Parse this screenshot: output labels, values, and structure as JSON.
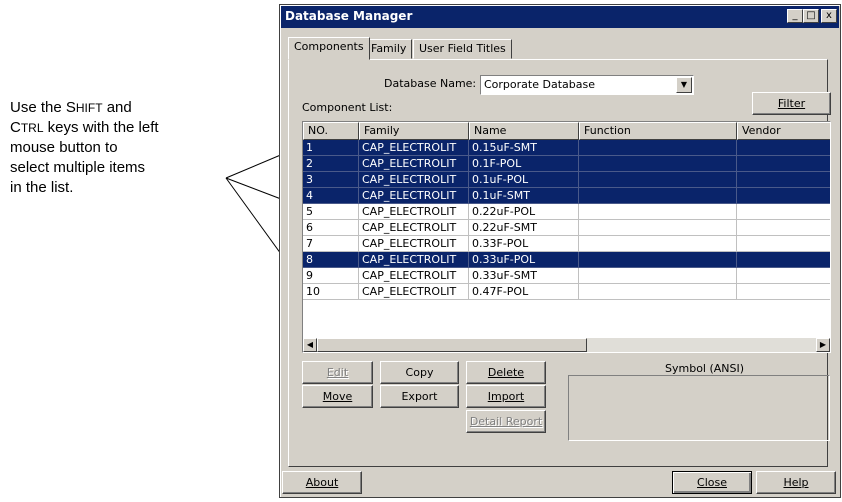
{
  "callout": {
    "line1_pre": "Use the S",
    "line1_sc": "HIFT",
    "line1_post": " and",
    "line2_pre": "C",
    "line2_sc": "TRL",
    "line2_post": " keys with the left",
    "line3": "mouse button to",
    "line4": "select multiple items",
    "line5": "in the list."
  },
  "window": {
    "title": "Database Manager",
    "minimize": "_",
    "maximize": "□",
    "close": "x"
  },
  "tabs": [
    "Components",
    "Family",
    "User Field Titles"
  ],
  "database": {
    "label": "Database Name:",
    "value": "Corporate Database"
  },
  "component_list_label": "Component List:",
  "filter_button": "Filter",
  "table": {
    "columns": [
      "NO.",
      "Family",
      "Name",
      "Function",
      "Vendor"
    ],
    "rows": [
      {
        "no": "1",
        "family": "CAP_ELECTROLIT",
        "name": "0.15uF-SMT",
        "function": "",
        "vendor": "",
        "selected": true
      },
      {
        "no": "2",
        "family": "CAP_ELECTROLIT",
        "name": "0.1F-POL",
        "function": "",
        "vendor": "",
        "selected": true
      },
      {
        "no": "3",
        "family": "CAP_ELECTROLIT",
        "name": "0.1uF-POL",
        "function": "",
        "vendor": "",
        "selected": true
      },
      {
        "no": "4",
        "family": "CAP_ELECTROLIT",
        "name": "0.1uF-SMT",
        "function": "",
        "vendor": "",
        "selected": true
      },
      {
        "no": "5",
        "family": "CAP_ELECTROLIT",
        "name": "0.22uF-POL",
        "function": "",
        "vendor": "",
        "selected": false
      },
      {
        "no": "6",
        "family": "CAP_ELECTROLIT",
        "name": "0.22uF-SMT",
        "function": "",
        "vendor": "",
        "selected": false
      },
      {
        "no": "7",
        "family": "CAP_ELECTROLIT",
        "name": "0.33F-POL",
        "function": "",
        "vendor": "",
        "selected": false
      },
      {
        "no": "8",
        "family": "CAP_ELECTROLIT",
        "name": "0.33uF-POL",
        "function": "",
        "vendor": "",
        "selected": true
      },
      {
        "no": "9",
        "family": "CAP_ELECTROLIT",
        "name": "0.33uF-SMT",
        "function": "",
        "vendor": "",
        "selected": false
      },
      {
        "no": "10",
        "family": "CAP_ELECTROLIT",
        "name": "0.47F-POL",
        "function": "",
        "vendor": "",
        "selected": false
      }
    ]
  },
  "buttons": {
    "edit": "Edit",
    "copy": "Copy",
    "delete": "Delete",
    "move": "Move",
    "export": "Export",
    "import": "Import",
    "detail_report": "Detail Report",
    "about": "About",
    "close": "Close",
    "help": "Help"
  },
  "symbol_label": "Symbol (ANSI)",
  "icons": {
    "scroll_left": "scroll-left-icon",
    "scroll_right": "scroll-right-icon",
    "combo_arrow": "chevron-down-icon"
  },
  "colors": {
    "selection": "#0a246a",
    "titlebar": "#0a246a",
    "face": "#d4d0c8"
  }
}
